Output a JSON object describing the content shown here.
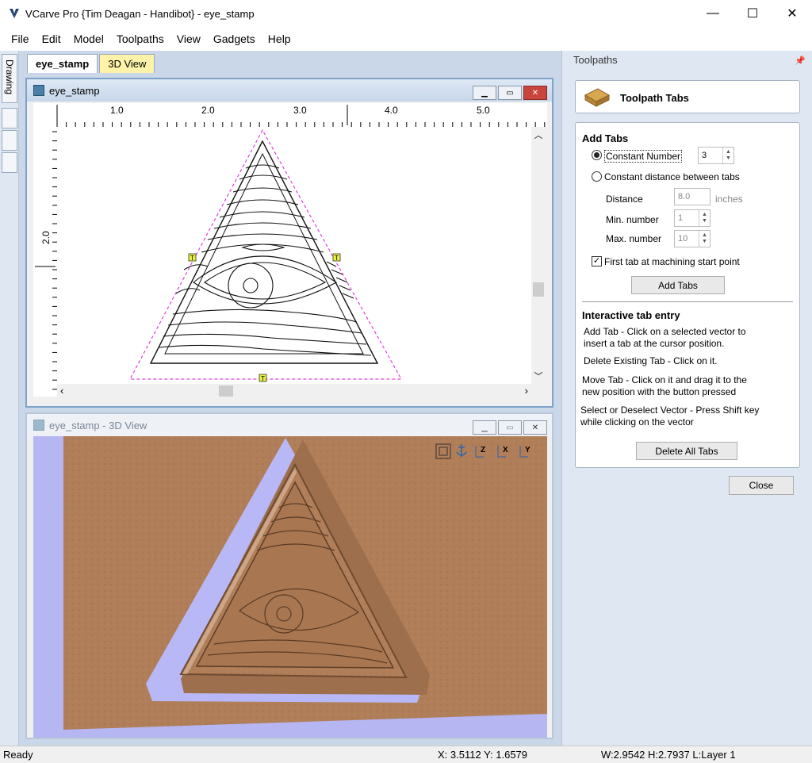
{
  "window": {
    "title": "VCarve Pro {Tim Deagan - Handibot} - eye_stamp",
    "minimize": "—",
    "maximize": "☐",
    "close": "✕"
  },
  "menu": [
    "File",
    "Edit",
    "Model",
    "Toolpaths",
    "View",
    "Gadgets",
    "Help"
  ],
  "left_strip": {
    "drawing_tab": "Drawing"
  },
  "doc_tabs": [
    "eye_stamp",
    "3D View"
  ],
  "view2d": {
    "title": "eye_stamp",
    "ruler_top": [
      "1.0",
      "2.0",
      "3.0",
      "4.0",
      "5.0"
    ],
    "ruler_left": [
      "2.0"
    ],
    "tab_marker": "T"
  },
  "view3d": {
    "title": "eye_stamp - 3D View",
    "toolbar_icons": [
      "zoom-extents-icon",
      "anchor-icon",
      "view-z-icon",
      "view-x-icon",
      "view-y-icon"
    ],
    "axis_labels": [
      "Z",
      "X",
      "Y"
    ]
  },
  "panel": {
    "header": "Toolpaths",
    "pin": "ꟷ",
    "title": "Toolpath Tabs",
    "add_tabs": {
      "heading": "Add Tabs",
      "constant_number_label": "Constant Number",
      "constant_number_value": "3",
      "constant_distance_label": "Constant distance between tabs",
      "distance_label": "Distance",
      "distance_value": "8.0",
      "distance_unit": "inches",
      "min_label": "Min. number",
      "min_value": "1",
      "max_label": "Max. number",
      "max_value": "10",
      "first_tab_label": "First tab at machining start point",
      "first_tab_checked": true,
      "add_button": "Add Tabs"
    },
    "interactive": {
      "heading": "Interactive tab entry",
      "add_line1": "Add Tab - Click on a selected vector to",
      "add_line2": "insert a tab at the cursor position.",
      "delete": "Delete Existing Tab - Click on it.",
      "move_line1": "Move Tab - Click on it and drag it to the",
      "move_line2": "new position with the button pressed",
      "select_line1": "Select or Deselect Vector - Press Shift key",
      "select_line2": "while clicking on the vector",
      "delete_all_button": "Delete All Tabs"
    },
    "close_button": "Close"
  },
  "status": {
    "ready": "Ready",
    "xy": "X:  3.5112 Y:  1.6579",
    "dims": "W:2.9542   H:2.7937   L:Layer 1"
  },
  "colors": {
    "wood": "#b07e58",
    "tab_marker": "#e6ef3d",
    "boundary": "#e040e0",
    "pocket": "#b7b8f5"
  }
}
